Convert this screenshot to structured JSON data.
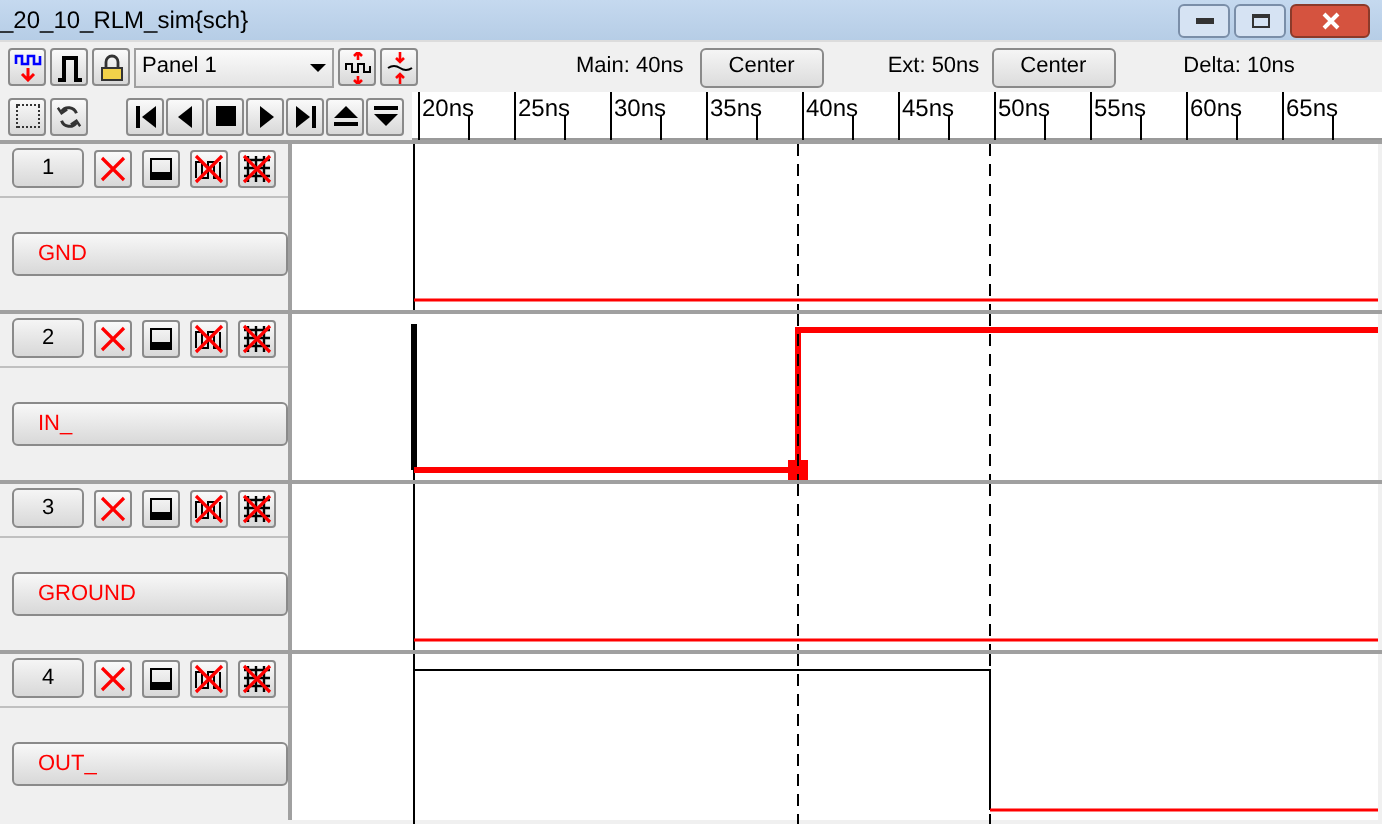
{
  "window": {
    "title": "_20_10_RLM_sim{sch}"
  },
  "toolbar": {
    "panel_select": "Panel 1",
    "main_label": "Main: 40ns",
    "main_button": "Center",
    "ext_label": "Ext: 50ns",
    "ext_button": "Center",
    "delta_label": "Delta: 10ns"
  },
  "ruler": {
    "ticks": [
      "20ns",
      "25ns",
      "30ns",
      "35ns",
      "40ns",
      "45ns",
      "50ns",
      "55ns",
      "60ns",
      "65ns"
    ]
  },
  "channels": [
    {
      "number": "1",
      "signal": "GND"
    },
    {
      "number": "2",
      "signal": "IN_"
    },
    {
      "number": "3",
      "signal": "GROUND"
    },
    {
      "number": "4",
      "signal": "OUT_"
    }
  ]
}
